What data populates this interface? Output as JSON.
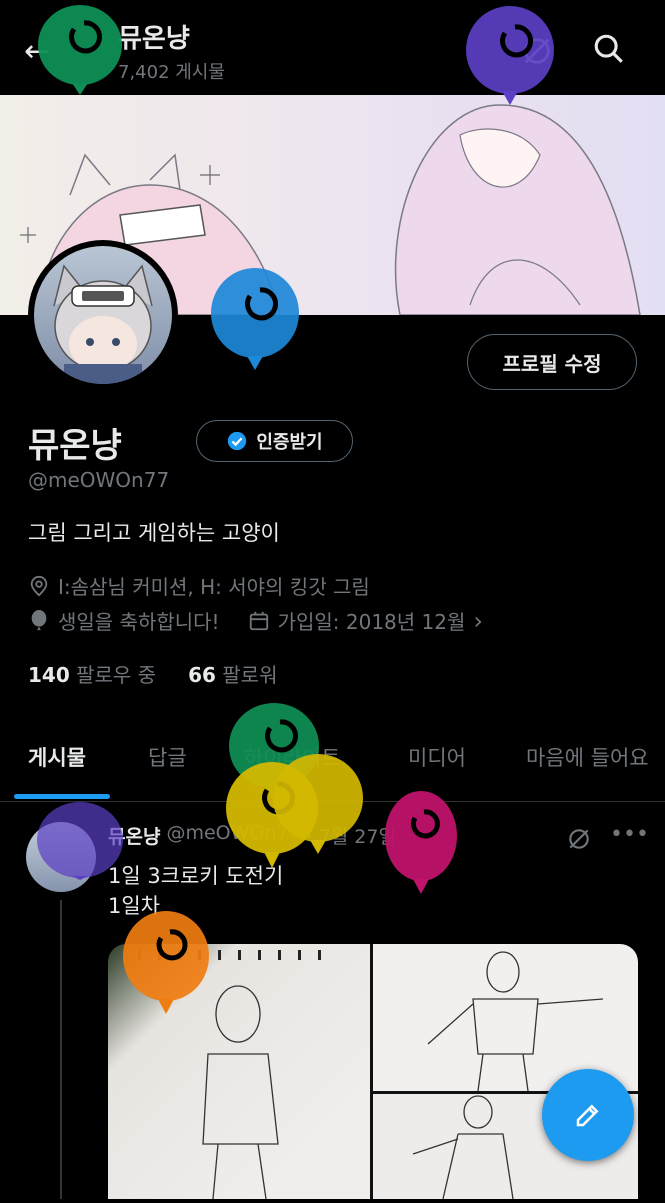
{
  "header": {
    "back_icon": "arrow-left-icon",
    "title": "뮤온냥",
    "post_count": "7,402 게시물"
  },
  "profile": {
    "edit_button": "프로필 수정",
    "display_name": "뮤온냥",
    "verify_button": "인증받기",
    "handle": "@meOWOn77",
    "bio": "그림 그리고 게임하는 고양이",
    "location": "I:솜삼님 커미션, H: 서야의 킹갓 그림",
    "birthday": "생일을 축하합니다!",
    "joined": "가입일: 2018년 12월",
    "following_count": "140",
    "following_label": "팔로우 중",
    "followers_count": "66",
    "followers_label": "팔로워"
  },
  "tabs": [
    "게시물",
    "답글",
    "하이라이트",
    "미디어",
    "마음에 들어요"
  ],
  "tweet": {
    "name": "뮤온냥",
    "handle": "@meOWOn77",
    "date": "· 7월 27일",
    "text_line1": "1일 3크로키 도전기",
    "text_line2": "1일차"
  },
  "colors": {
    "accent": "#1d9bf0",
    "muted": "#71767b",
    "text": "#e7e9ea",
    "background": "#000000"
  }
}
